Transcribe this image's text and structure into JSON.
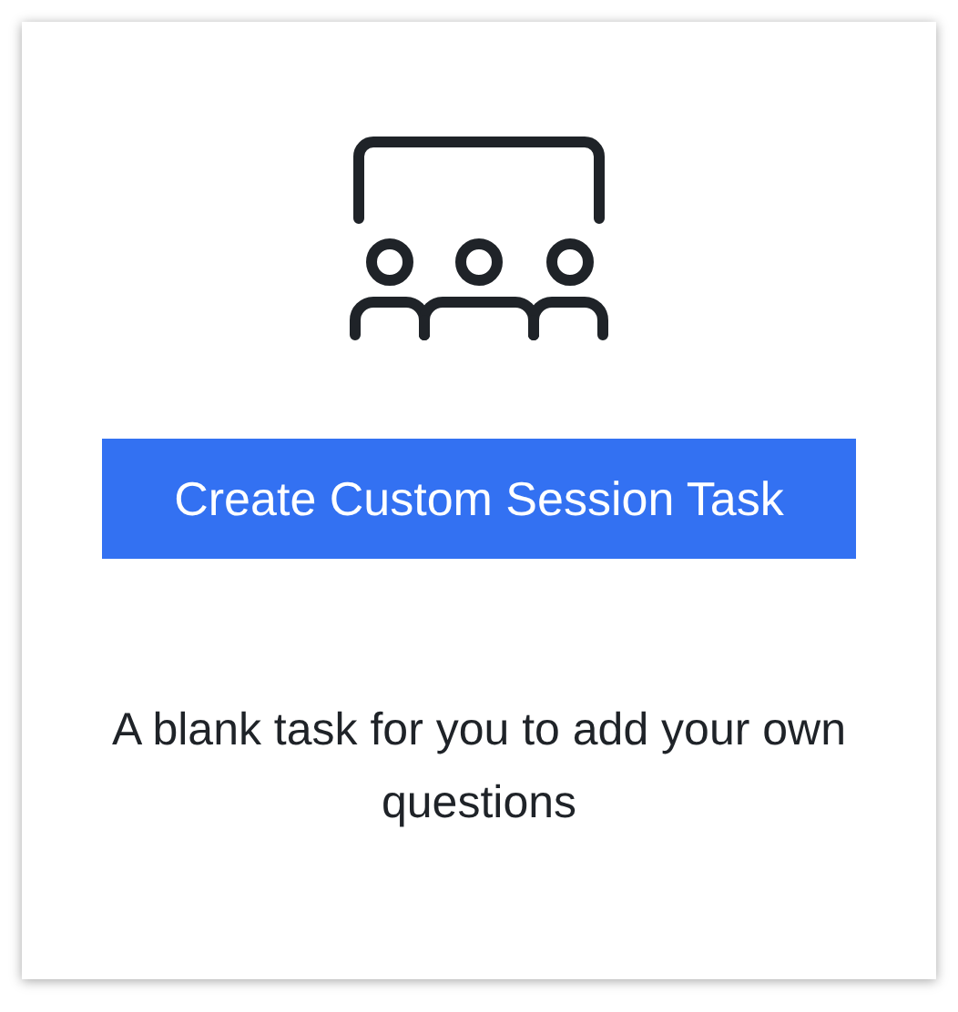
{
  "card": {
    "button": "Create Custom Session Task",
    "description": "A blank task for you to add your own questions"
  }
}
